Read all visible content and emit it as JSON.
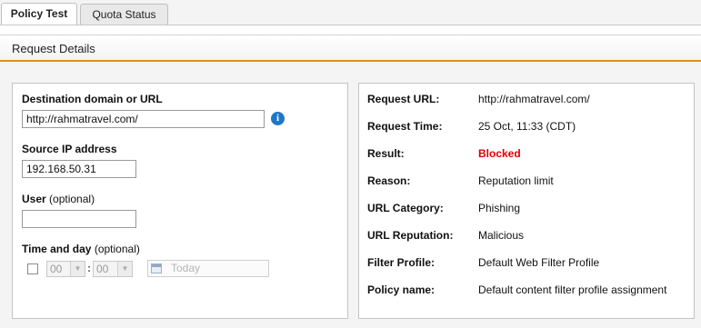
{
  "tabs": [
    {
      "label": "Policy Test",
      "active": true
    },
    {
      "label": "Quota Status",
      "active": false
    }
  ],
  "panel": {
    "title": "Request Details"
  },
  "form": {
    "destination": {
      "label": "Destination domain or URL",
      "value": "http://rahmatravel.com/",
      "info_icon": "info-icon"
    },
    "source_ip": {
      "label": "Source IP address",
      "value": "192.168.50.31"
    },
    "user": {
      "label": "User",
      "label_suffix": "(optional)",
      "value": ""
    },
    "time_day": {
      "label": "Time and day",
      "label_suffix": "(optional)",
      "checked": false,
      "hour": "00",
      "minute": "00",
      "separator": ":",
      "date_placeholder": "Today",
      "calendar_icon": "calendar-icon"
    }
  },
  "result": {
    "rows": [
      {
        "label": "Request URL:",
        "value": "http://rahmatravel.com/"
      },
      {
        "label": "Request Time:",
        "value": "25 Oct, 11:33 (CDT)"
      },
      {
        "label": "Result:",
        "value": "Blocked",
        "status_color": "#e00000"
      },
      {
        "label": "Reason:",
        "value": "Reputation limit"
      },
      {
        "label": "URL Category:",
        "value": "Phishing"
      },
      {
        "label": "URL Reputation:",
        "value": "Malicious"
      },
      {
        "label": "Filter Profile:",
        "value": "Default Web Filter Profile"
      },
      {
        "label": "Policy name:",
        "value": "Default content filter profile assignment"
      }
    ]
  },
  "colors": {
    "accent": "#e08d19",
    "info": "#1f77c8"
  }
}
